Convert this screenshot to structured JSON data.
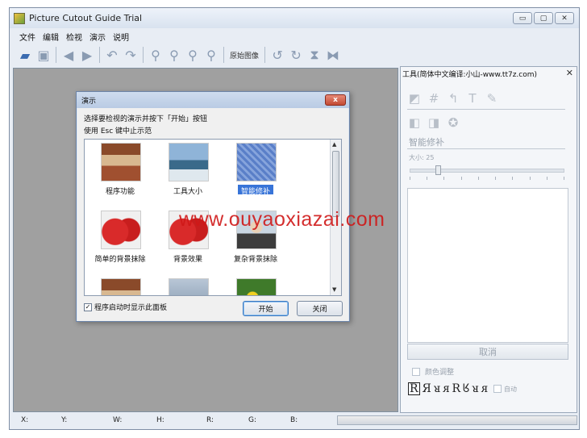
{
  "app": {
    "title": "Picture Cutout Guide Trial",
    "window_buttons": [
      "▭",
      "▢",
      "✕"
    ]
  },
  "menu": [
    "文件",
    "编辑",
    "检视",
    "演示",
    "说明"
  ],
  "toolbar": {
    "original_image_label": "原始图像",
    "icons": [
      "open-icon",
      "save-icon",
      "back-icon",
      "forward-icon",
      "undo-icon",
      "redo-icon",
      "zoom-in-icon",
      "zoom-out-icon",
      "zoom-fit-icon",
      "zoom-actual-icon",
      "rotate-left-icon",
      "rotate-right-icon",
      "flip-vertical-icon",
      "flip-horizontal-icon"
    ]
  },
  "status": {
    "x": "X:",
    "y": "Y:",
    "w": "W:",
    "h": "H:",
    "r": "R:",
    "g": "G:",
    "b": "B:"
  },
  "panel": {
    "title": "工具(简体中文编译:小山-www.tt7z.com)",
    "close": "✕",
    "smart_repair": "智能修补",
    "size_label": "大小: 25",
    "size_value": 25,
    "cancel": "取消",
    "color_adjust": "颜色调整",
    "auto": "自动",
    "glyphs": [
      "R",
      "Я",
      "ᴚ",
      "ᴙ",
      "R",
      "ᖉ",
      "ᴚ",
      "ᴙ"
    ]
  },
  "dialog": {
    "title": "演示",
    "close": "x",
    "line1": "选择要检视的演示并按下「开始」按钮",
    "line2": "使用 Esc 键中止示范",
    "items": [
      {
        "label": "程序功能",
        "thumb": "t-house"
      },
      {
        "label": "工具大小",
        "thumb": "t-water"
      },
      {
        "label": "智能修补",
        "thumb": "t-blue",
        "selected": true
      },
      {
        "label": "简单的背景抹除",
        "thumb": "t-berry"
      },
      {
        "label": "背景效果",
        "thumb": "t-berry"
      },
      {
        "label": "复杂背景抹除",
        "thumb": "t-person"
      },
      {
        "label": "",
        "thumb": "t-house"
      },
      {
        "label": "",
        "thumb": "t-sky"
      },
      {
        "label": "",
        "thumb": "t-flower"
      }
    ],
    "show_on_startup": "程序启动时显示此面板",
    "show_on_startup_checked": true,
    "start": "开始",
    "close_button": "关闭"
  },
  "watermark": "www.ouyaoxiazai.com"
}
